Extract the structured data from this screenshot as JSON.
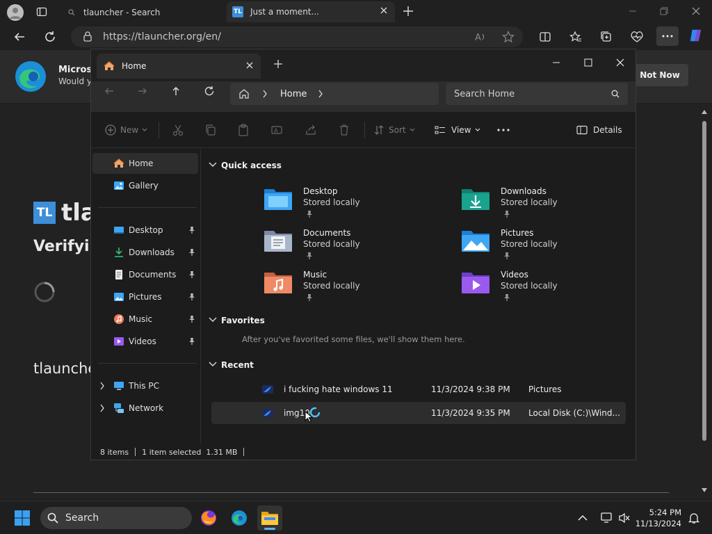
{
  "browser": {
    "tabs": [
      {
        "label": "tlauncher - Search"
      },
      {
        "label": "Just a moment...",
        "favicon": "TL"
      }
    ],
    "address": "https://tlauncher.org/en/",
    "banner": {
      "title": "Microso",
      "subtitle": "Would y",
      "not_now": "Not Now"
    }
  },
  "page": {
    "logo_text": "TL",
    "brand": "tla",
    "verify": "Verifyin",
    "bottom": "tlaunche"
  },
  "explorer": {
    "tab_label": "Home",
    "breadcrumb": "Home",
    "search_placeholder": "Search Home",
    "toolbar": {
      "new": "New",
      "sort": "Sort",
      "view": "View",
      "details": "Details"
    },
    "sidebar": {
      "home": "Home",
      "gallery": "Gallery",
      "desktop": "Desktop",
      "downloads": "Downloads",
      "documents": "Documents",
      "pictures": "Pictures",
      "music": "Music",
      "videos": "Videos",
      "this_pc": "This PC",
      "network": "Network"
    },
    "quick_access": {
      "title": "Quick access",
      "items": [
        {
          "name": "Desktop",
          "status": "Stored locally"
        },
        {
          "name": "Downloads",
          "status": "Stored locally"
        },
        {
          "name": "Documents",
          "status": "Stored locally"
        },
        {
          "name": "Pictures",
          "status": "Stored locally"
        },
        {
          "name": "Music",
          "status": "Stored locally"
        },
        {
          "name": "Videos",
          "status": "Stored locally"
        }
      ]
    },
    "favorites": {
      "title": "Favorites",
      "empty": "After you've favorited some files, we'll show them here."
    },
    "recent": {
      "title": "Recent",
      "rows": [
        {
          "name": "i fucking hate windows 11",
          "date": "11/3/2024 9:38 PM",
          "location": "Pictures"
        },
        {
          "name": "img10",
          "date": "11/3/2024 9:35 PM",
          "location": "Local Disk (C:)\\Wind..."
        }
      ]
    },
    "status": {
      "items": "8 items",
      "selected": "1 item selected",
      "size": "1.31 MB"
    }
  },
  "taskbar": {
    "search": "Search",
    "time": "5:24 PM",
    "date": "11/13/2024"
  },
  "colors": {
    "accent": "#4cc2ff",
    "folder_blue": "#3ea6f4",
    "folder_teal": "#19a38f"
  }
}
